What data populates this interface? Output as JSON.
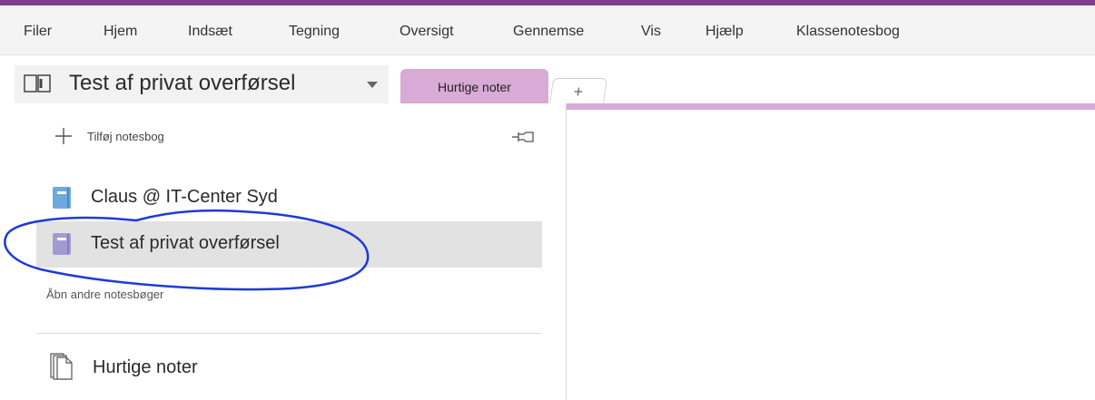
{
  "ribbon": {
    "tabs": [
      "Filer",
      "Hjem",
      "Indsæt",
      "Tegning",
      "Oversigt",
      "Gennemse",
      "Vis",
      "Hjælp",
      "Klassenotesbog"
    ]
  },
  "notebook": {
    "title": "Test af privat overførsel"
  },
  "sections": {
    "active_tab": "Hurtige noter",
    "add_tab": "+"
  },
  "panel": {
    "add_notebook_label": "Tilføj notesbog",
    "notebooks": [
      {
        "name": "Claus @ IT-Center Syd",
        "color": "#6ea9dc",
        "selected": false
      },
      {
        "name": "Test af privat overførsel",
        "color": "#a29bd2",
        "selected": true
      }
    ],
    "open_other_label": "Åbn andre notesbøger",
    "quick_notes_label": "Hurtige noter"
  },
  "colors": {
    "brand": "#7b3f8c",
    "section_tab": "#d8aad6",
    "annotation": "#1f3ad6"
  }
}
